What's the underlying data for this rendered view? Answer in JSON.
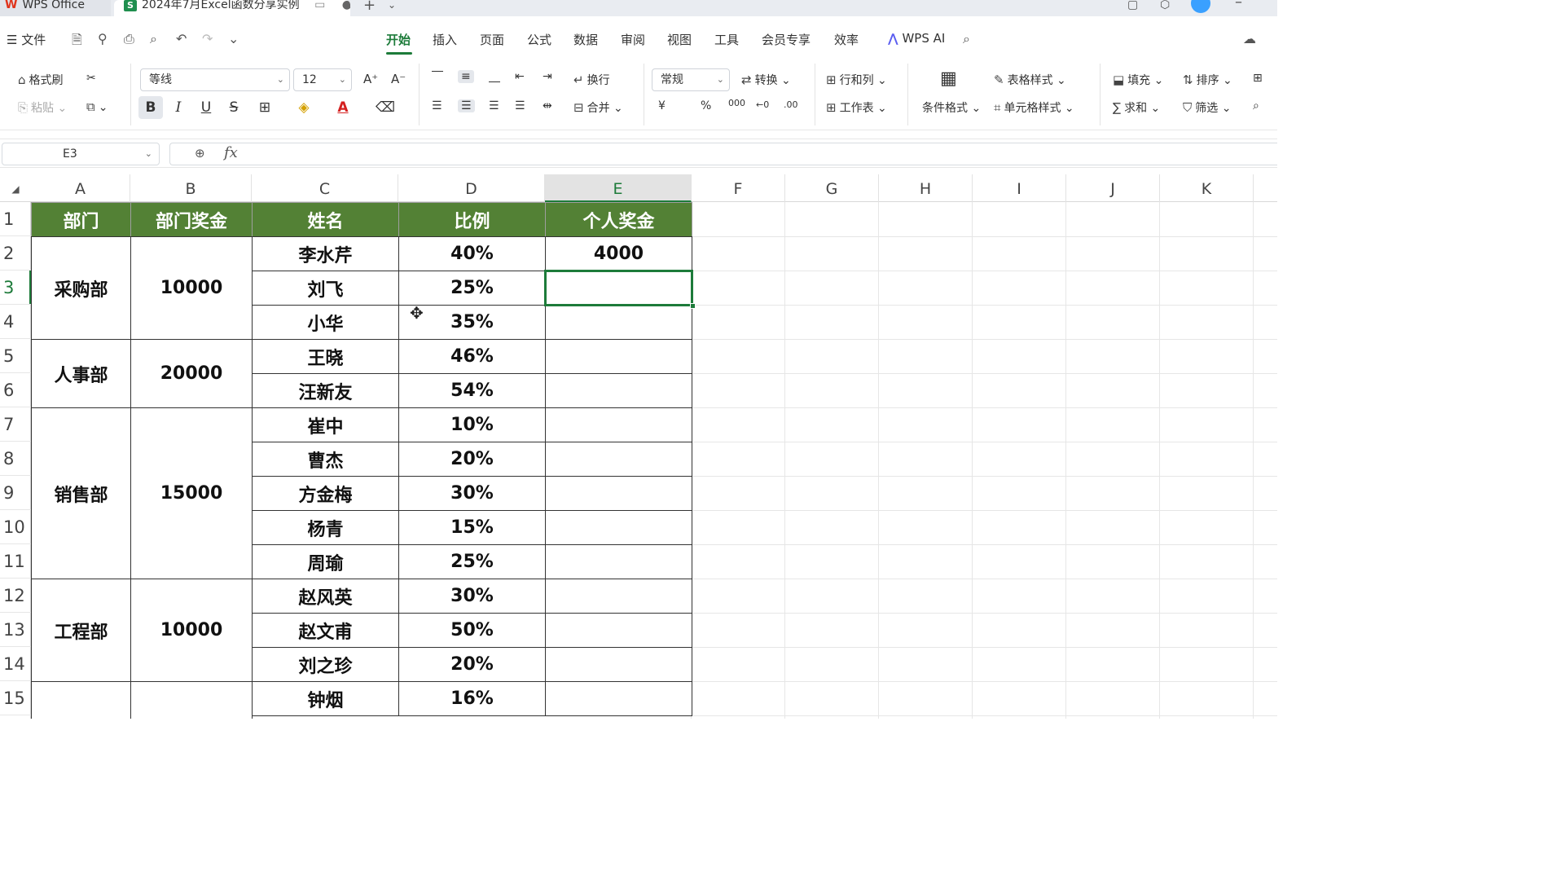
{
  "titlebar": {
    "home_tab": "WPS Office",
    "doc_tab": "2024年7月Excel函数分享实例",
    "doc_icon": "S",
    "add_tab": "+"
  },
  "menubar": {
    "file": "文件",
    "tabs": [
      "开始",
      "插入",
      "页面",
      "公式",
      "数据",
      "审阅",
      "视图",
      "工具",
      "会员专享",
      "效率"
    ],
    "active_tab": "开始",
    "wps_ai": "WPS AI"
  },
  "ribbon": {
    "format_painter": "格式刷",
    "paste": "粘贴",
    "font_name": "等线",
    "font_size": "12",
    "wrap": "换行",
    "merge": "合并",
    "number_format": "常规",
    "convert": "转换",
    "rows_cols": "行和列",
    "worksheet": "工作表",
    "conditional_format": "条件格式",
    "table_style": "表格样式",
    "cell_style": "单元格样式",
    "fill": "填充",
    "sort": "排序",
    "sum": "求和",
    "filter": "筛选",
    "bold": "B",
    "italic": "I",
    "underline": "U",
    "strike": "S",
    "font_color_letter": "A",
    "percent": "%",
    "currency": "¥",
    "thousands": "000",
    "dec_increase": "←0",
    "dec_decrease": ".00",
    "grow_font": "A⁺",
    "shrink_font": "A⁻"
  },
  "formula_bar": {
    "name_box": "E3",
    "fx": "fx",
    "content": ""
  },
  "sheet": {
    "columns": [
      "A",
      "B",
      "C",
      "D",
      "E",
      "F",
      "G",
      "H",
      "I",
      "J",
      "K"
    ],
    "selected_column": "E",
    "rows": [
      "1",
      "2",
      "3",
      "4",
      "5",
      "6",
      "7",
      "8",
      "9",
      "10",
      "11",
      "12",
      "13",
      "14",
      "15"
    ],
    "selected_row": "3",
    "selected_cell": "E3",
    "header": [
      "部门",
      "部门奖金",
      "姓名",
      "比例",
      "个人奖金"
    ],
    "departments": [
      {
        "name": "采购部",
        "bonus": "10000"
      },
      {
        "name": "人事部",
        "bonus": "20000"
      },
      {
        "name": "销售部",
        "bonus": "15000"
      },
      {
        "name": "工程部",
        "bonus": "10000"
      }
    ],
    "people": [
      {
        "name": "李水芹",
        "ratio": "40%",
        "personal": "4000"
      },
      {
        "name": "刘飞",
        "ratio": "25%",
        "personal": ""
      },
      {
        "name": "小华",
        "ratio": "35%",
        "personal": ""
      },
      {
        "name": "王晓",
        "ratio": "46%",
        "personal": ""
      },
      {
        "name": "汪新友",
        "ratio": "54%",
        "personal": ""
      },
      {
        "name": "崔中",
        "ratio": "10%",
        "personal": ""
      },
      {
        "name": "曹杰",
        "ratio": "20%",
        "personal": ""
      },
      {
        "name": "方金梅",
        "ratio": "30%",
        "personal": ""
      },
      {
        "name": "杨青",
        "ratio": "15%",
        "personal": ""
      },
      {
        "name": "周瑜",
        "ratio": "25%",
        "personal": ""
      },
      {
        "name": "赵风英",
        "ratio": "30%",
        "personal": ""
      },
      {
        "name": "赵文甫",
        "ratio": "50%",
        "personal": ""
      },
      {
        "name": "刘之珍",
        "ratio": "20%",
        "personal": ""
      },
      {
        "name": "钟烟",
        "ratio": "16%",
        "personal": ""
      }
    ],
    "header_color": "#538135",
    "accent_color": "#1d7b3a"
  }
}
